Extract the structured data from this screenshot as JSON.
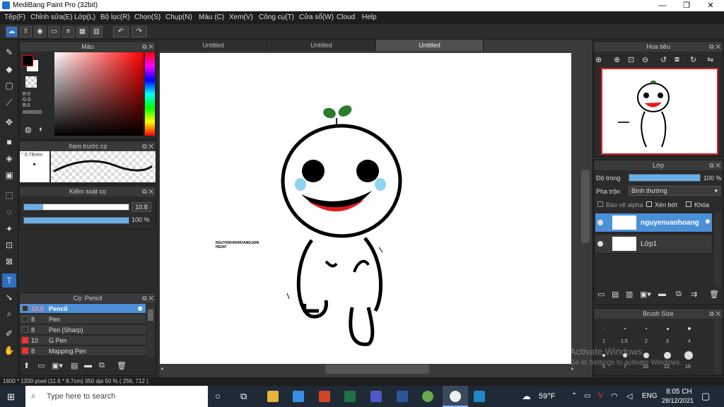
{
  "window": {
    "title": "MediBang Paint Pro (32bit)",
    "min": "—",
    "max": "❐",
    "close": "✕"
  },
  "menu": [
    "Tệp(F)",
    "Chỉnh sửa(E)",
    "Lớp(L)",
    "Bộ lọc(R)",
    "Chọn(S)",
    "Chụp(N)",
    "Màu (C)",
    "Xem(V)",
    "Công cụ(T)",
    "Cửa sổ(W)",
    "Cloud",
    "Help"
  ],
  "tabs": [
    "Untitled",
    "Untitled",
    "Untitled"
  ],
  "color_panel": {
    "title": "Màu",
    "r": "R:0",
    "g": "G:0",
    "b": "B:0",
    "hex": "#000000",
    "foreground": "#000000",
    "background": "#ffffff"
  },
  "brush_preview": {
    "title": "Xem trước cọ",
    "size": "° 0.78mm"
  },
  "brush_control": {
    "title": "Kiểm soát cọ",
    "size_value": "10.8",
    "opacity_value": "100 %",
    "size_fraction": 0.18,
    "opacity_fraction": 1.0
  },
  "brush_panel": {
    "title": "Cọ: Pencil",
    "items": [
      {
        "size": "10.8",
        "name": "Pencil"
      },
      {
        "size": "8",
        "name": "Pen"
      },
      {
        "size": "8",
        "name": "Pen (Sharp)"
      },
      {
        "size": "10",
        "name": "G Pen"
      },
      {
        "size": "8",
        "name": "Mapping Pen"
      }
    ]
  },
  "navigator": {
    "title": "Hoa tiêu"
  },
  "layers": {
    "title": "Lớp",
    "opacity_label": "Độ trong",
    "opacity_value": "100 %",
    "blend_label": "Pha trộn",
    "blend_value": "Bình thường",
    "protect_alpha": "Bảo vệ alpha",
    "clipping": "Xén bớt",
    "lock": "Khóa",
    "items": [
      "nguyenvanhoang",
      "Lớp1"
    ]
  },
  "brush_size": {
    "title": "Brush Size",
    "labels": [
      "1",
      "1.5",
      "2",
      "3",
      "4",
      "5",
      "7",
      "10",
      "12",
      "15"
    ]
  },
  "canvas": {
    "signature_line1": "NGUYENVANHOANG1606",
    "signature_line2": "HD247"
  },
  "watermark": {
    "line1": "Activate Windows",
    "line2": "Go to Settings to activate Windows."
  },
  "status": {
    "text": "1600 * 1200 pixel   (11.6 * 8.7cm)   350 dpi   50 %   ( 256, 712 )"
  },
  "taskbar": {
    "search_placeholder": "Type here to search",
    "weather": "59°F",
    "lang": "ENG",
    "time": "8:05 CH",
    "date": "28/12/2021"
  }
}
